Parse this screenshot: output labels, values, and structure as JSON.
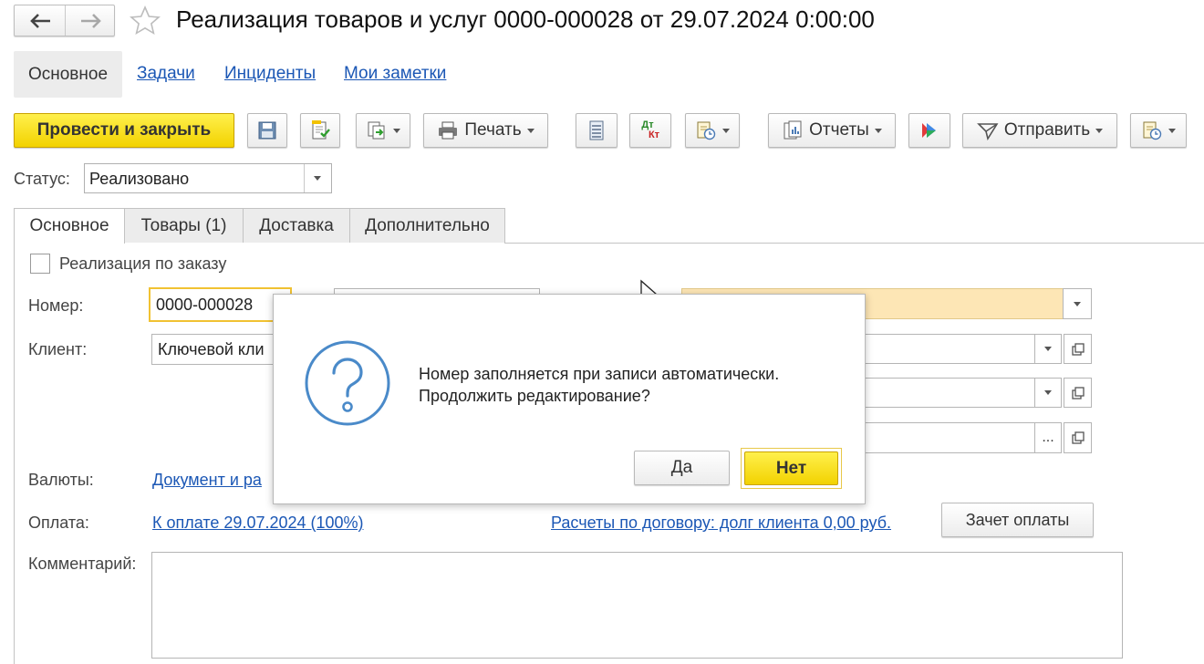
{
  "window": {
    "title": "Реализация товаров и услуг 0000-000028 от 29.07.2024 0:00:00"
  },
  "sections": {
    "active": "Основное",
    "links": [
      "Задачи",
      "Инциденты",
      "Мои заметки"
    ]
  },
  "toolbar": {
    "post_and_close": "Провести и закрыть",
    "print": "Печать",
    "reports": "Отчеты",
    "send": "Отправить",
    "dt_kt_top": "Дт",
    "dt_kt_bottom": "Кт"
  },
  "status": {
    "label": "Статус:",
    "value": "Реализовано"
  },
  "tabs": [
    "Основное",
    "Товары (1)",
    "Доставка",
    "Дополнительно"
  ],
  "form": {
    "by_order_label": "Реализация по заказу",
    "number_label": "Номер:",
    "number_value": "0000-000028",
    "client_label": "Клиент:",
    "client_value": "Ключевой кли",
    "currency_label": "Валюты:",
    "currency_link": "Документ и ра",
    "payment_label": "Оплата:",
    "payment_link": "К оплате 29.07.2024 (100%)",
    "settlement_link": "Расчеты по договору: долг клиента 0,00 руб.",
    "offset_button": "Зачет оплаты",
    "comment_label": "Комментарий:",
    "ellipsis": "..."
  },
  "dialog": {
    "message_line1": "Номер заполняется при записи автоматически.",
    "message_line2": "Продолжить редактирование?",
    "yes": "Да",
    "no": "Нет"
  },
  "colors": {
    "accent_yellow": "#f5d800",
    "link_blue": "#1b57b5",
    "question_icon": "#4a8ac9",
    "highlight_field": "#fde6b5"
  }
}
